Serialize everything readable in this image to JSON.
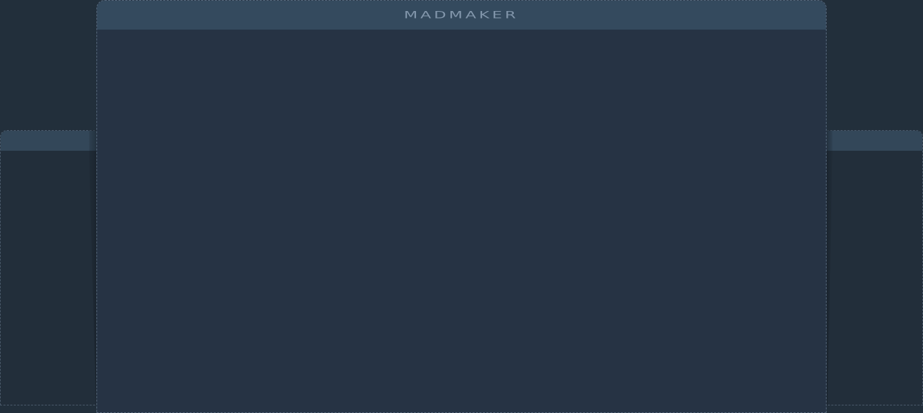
{
  "app": {
    "title": "MADMAKER"
  },
  "colors": {
    "page_background": "#222f3b",
    "panel_background": "#263344",
    "header_background": "#344a5e",
    "title_color": "#8296ab",
    "border_dashed": "#56687c"
  }
}
